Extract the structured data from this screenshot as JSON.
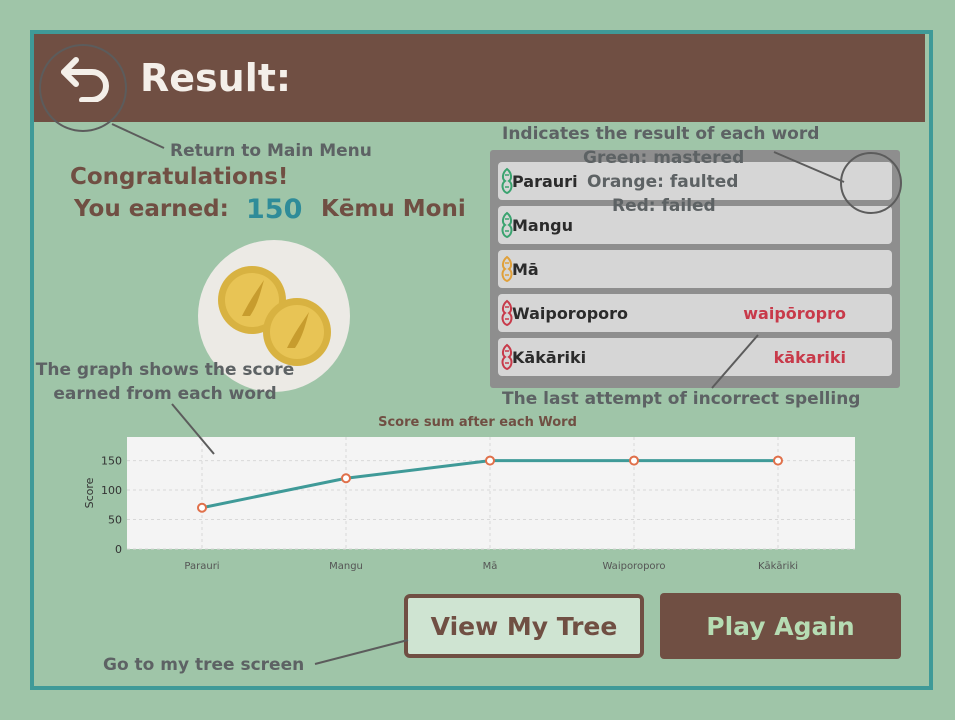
{
  "header": {
    "title": "Result:"
  },
  "annotations": {
    "return_menu": "Return to Main Menu",
    "result_legend": [
      "Indicates the result of each word",
      "Green: mastered",
      "Orange: faulted",
      "Red: failed"
    ],
    "graph_note": [
      "The graph shows the score",
      "earned from each word"
    ],
    "last_attempt": "The last attempt of incorrect spelling",
    "tree_note": "Go to my tree screen"
  },
  "summary": {
    "congrats": "Congratulations!",
    "earned_label": "You earned:",
    "earned_value": "150",
    "currency": "Kēmu Moni"
  },
  "words": [
    {
      "word": "Parauri",
      "attempt": "",
      "status": "mastered"
    },
    {
      "word": "Mangu",
      "attempt": "",
      "status": "mastered"
    },
    {
      "word": "Mā",
      "attempt": "",
      "status": "faulted"
    },
    {
      "word": "Waiporoporo",
      "attempt": "waipōropro",
      "status": "failed"
    },
    {
      "word": "Kākāriki",
      "attempt": "kākariki",
      "status": "failed"
    }
  ],
  "status_colors": {
    "mastered": "#3aa36f",
    "faulted": "#e0a03a",
    "failed": "#c83a4a"
  },
  "chart_data": {
    "type": "line",
    "title": "Score sum after each Word",
    "xlabel": "",
    "ylabel": "Score",
    "categories": [
      "Parauri",
      "Mangu",
      "Mā",
      "Waiporoporo",
      "Kākāriki"
    ],
    "values": [
      70,
      120,
      150,
      150,
      150
    ],
    "ylim": [
      0,
      190
    ],
    "yticks": [
      0,
      50,
      100,
      150
    ],
    "grid": true,
    "line_color": "#3f9a98",
    "marker_color": "#e0704a"
  },
  "buttons": {
    "view_tree": "View My Tree",
    "play_again": "Play Again"
  }
}
